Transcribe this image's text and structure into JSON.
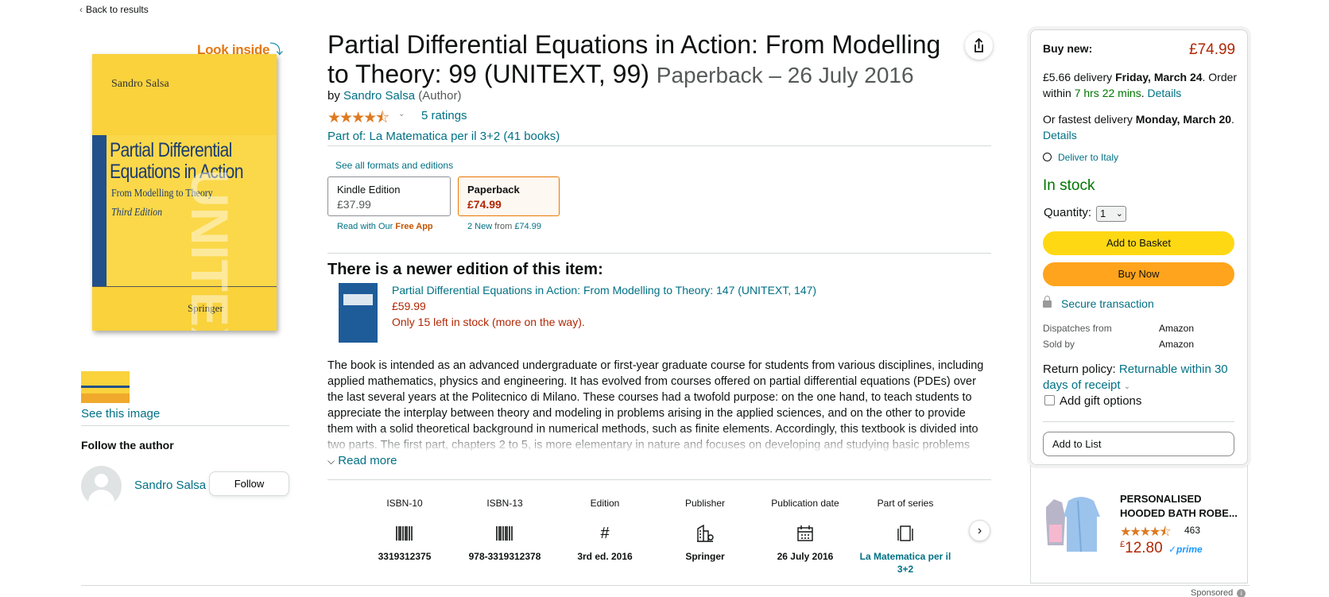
{
  "nav": {
    "back_label": "Back to results"
  },
  "left": {
    "look_inside": "Look inside",
    "cover": {
      "author": "Sandro Salsa",
      "title": "Partial Differential Equations in Action",
      "subtitle": "From Modelling to Theory",
      "edition": "Third Edition",
      "publisher": "Springer",
      "series": "UNITEXT"
    },
    "see_image": "See this image",
    "follow_title": "Follow the author",
    "author_name": "Sandro Salsa",
    "follow_button": "Follow"
  },
  "product": {
    "title": "Partial Differential Equations in Action: From Modelling to Theory: 99 (UNITEXT, 99)",
    "format_date": "Paperback – 26 July 2016",
    "by": "by",
    "author": "Sandro Salsa",
    "author_role": "(Author)",
    "stars": "★★★★⯪",
    "rating_value": 4.5,
    "ratings": "5 ratings",
    "part_of": "Part of: La Matematica per il 3+2 (41 books)",
    "see_all_formats": "See all formats and editions",
    "formats": [
      {
        "name": "Kindle Edition",
        "price": "£37.99"
      },
      {
        "name": "Paperback",
        "price": "£74.99"
      }
    ],
    "read_with": "Read with Our",
    "free_app": "Free App",
    "new_count": "2 New",
    "new_from_word": "from",
    "new_from_price": "£74.99"
  },
  "newer_edition": {
    "heading": "There is a newer edition of this item:",
    "title": "Partial Differential Equations in Action: From Modelling to Theory: 147 (UNITEXT, 147)",
    "price": "£59.99",
    "stock": "Only 15 left in stock (more on the way)."
  },
  "description": {
    "text": "The book is intended as an advanced undergraduate or first-year graduate course for students from various disciplines, including applied mathematics, physics and engineering. It has evolved from courses offered on partial differential equations (PDEs) over the last several years at the Politecnico di Milano. These courses had a twofold purpose: on the one hand, to teach students to appreciate the interplay between theory and modeling in problems arising in the applied sciences, and on the other to provide them with a solid theoretical background in numerical methods, such as finite elements. Accordingly, this textbook is divided into two parts. The first part, chapters 2 to 5, is more elementary in nature and focuses on developing and studying basic problems",
    "read_more": "Read more"
  },
  "attributes": [
    {
      "label": "ISBN-10",
      "icon": "barcode-icon",
      "glyph": "▌▍▌▍▌",
      "value": "3319312375",
      "link": false
    },
    {
      "label": "ISBN-13",
      "icon": "barcode-icon",
      "glyph": "▌▍▌▍▌",
      "value": "978-3319312378",
      "link": false
    },
    {
      "label": "Edition",
      "icon": "hash-icon",
      "glyph": "#",
      "value": "3rd ed. 2016",
      "link": false
    },
    {
      "label": "Publisher",
      "icon": "building-icon",
      "glyph": "⌂",
      "value": "Springer",
      "link": false
    },
    {
      "label": "Publication date",
      "icon": "calendar-icon",
      "glyph": "▦",
      "value": "26 July 2016",
      "link": false
    },
    {
      "label": "Part of series",
      "icon": "books-icon",
      "glyph": "▯",
      "value": "La Matematica per il 3+2",
      "link": true
    }
  ],
  "buybox": {
    "buy_new": "Buy new:",
    "price": "£74.99",
    "delivery_prefix": "£5.66 delivery",
    "delivery_date": "Friday, March 24",
    "order_within_prefix": "Order within",
    "order_within": "7 hrs 22 mins",
    "details": "Details",
    "fastest_prefix": "Or fastest delivery",
    "fastest_date": "Monday, March 20",
    "deliver_to": "Deliver to Italy",
    "in_stock": "In stock",
    "quantity_label": "Quantity:",
    "quantity_value": "1",
    "add_to_basket": "Add to Basket",
    "buy_now": "Buy Now",
    "secure": "Secure transaction",
    "dispatches_label": "Dispatches from",
    "dispatches_value": "Amazon",
    "sold_label": "Sold by",
    "sold_value": "Amazon",
    "return_label": "Return policy:",
    "return_value": "Returnable within 30 days of receipt",
    "gift_label": "Add gift options",
    "add_to_list": "Add to List"
  },
  "ad": {
    "title": "PERSONALISED HOODED BATH ROBE...",
    "stars": "★★★★⯪",
    "rating_count": "463",
    "currency": "£",
    "price": "12.80",
    "prime": "✓prime",
    "sponsored": "Sponsored"
  },
  "colors": {
    "link": "#007185",
    "price": "#b12704",
    "in_stock": "#007600",
    "basket": "#ffd814",
    "buy_now": "#ffa41c"
  }
}
